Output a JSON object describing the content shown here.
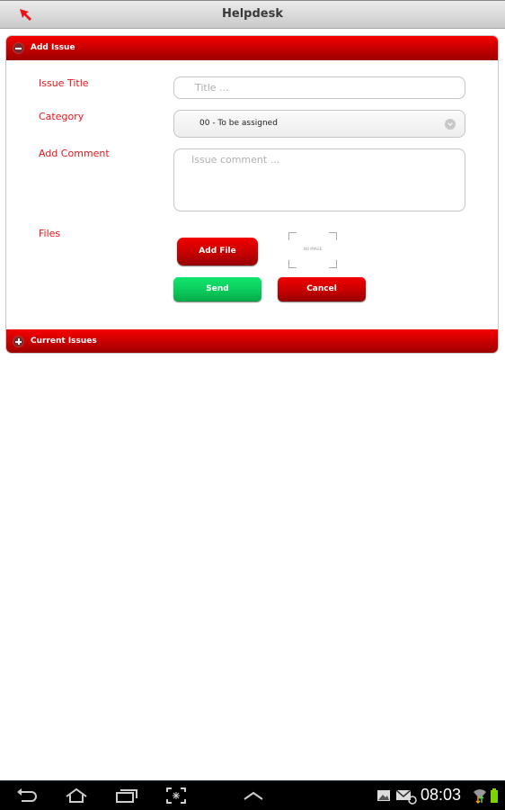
{
  "app": {
    "title": "Helpdesk"
  },
  "sections": {
    "add_issue": {
      "label": "Add Issue",
      "state": "expanded"
    },
    "current_issues": {
      "label": "Current Issues",
      "state": "collapsed"
    }
  },
  "form": {
    "issue_title": {
      "label": "Issue Title",
      "placeholder": "Title ...",
      "value": ""
    },
    "category": {
      "label": "Category",
      "selected": "00 - To be assigned"
    },
    "comment": {
      "label": "Add Comment",
      "placeholder": "Issue comment ...",
      "value": ""
    },
    "files": {
      "label": "Files",
      "add_file_label": "Add File",
      "preview_text": "NO IMAGE"
    },
    "send_label": "Send",
    "cancel_label": "Cancel"
  },
  "status_bar": {
    "time": "08:03"
  },
  "colors": {
    "accent_red": "#e8141a",
    "send_green": "#0ac85a"
  }
}
